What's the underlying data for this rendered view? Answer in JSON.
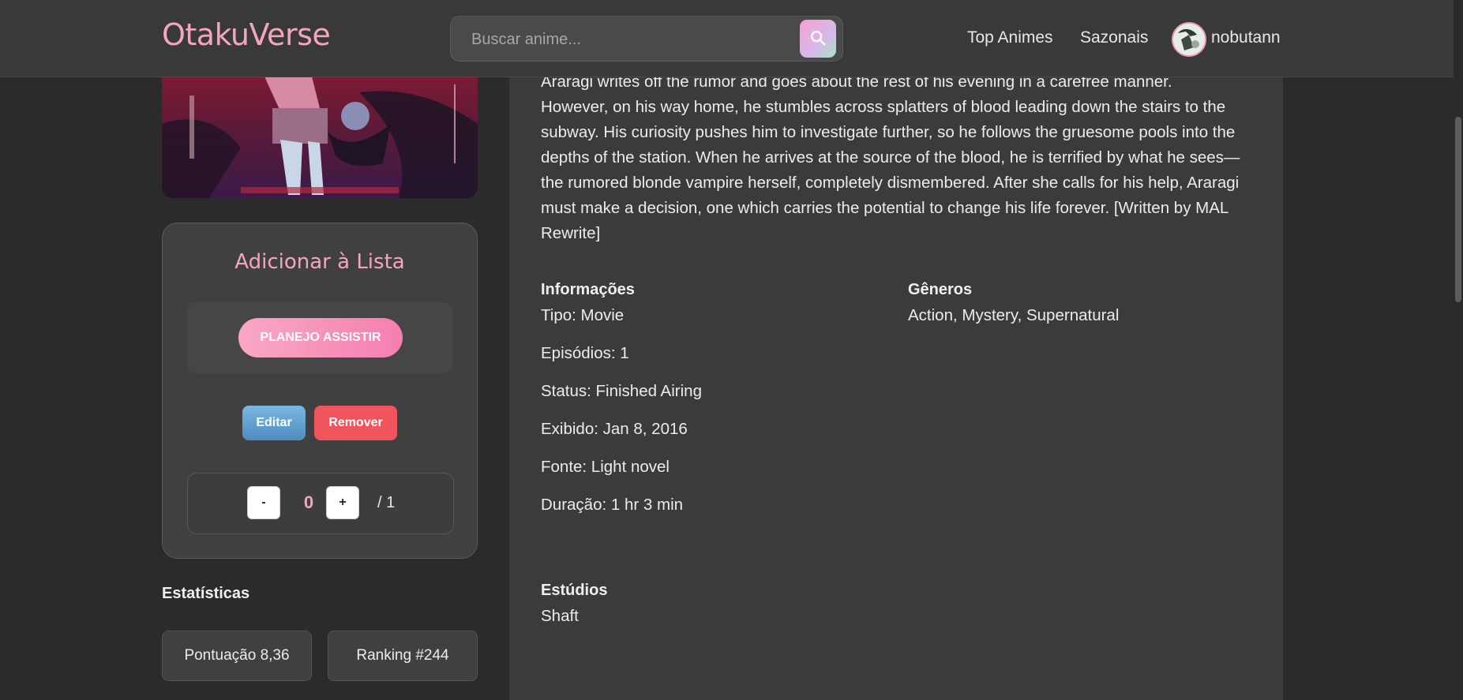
{
  "header": {
    "logo": "OtakuVerse",
    "search": {
      "placeholder": "Buscar anime..."
    },
    "nav": {
      "top": "Top Animes",
      "seasonal": "Sazonais"
    },
    "user": {
      "name": "nobutann"
    }
  },
  "list_card": {
    "title": "Adicionar à Lista",
    "status_button": "PLANEJO ASSISTIR",
    "edit": "Editar",
    "remove": "Remover",
    "minus": "-",
    "plus": "+",
    "progress": "0",
    "total": "/ 1"
  },
  "stats": {
    "heading": "Estatísticas",
    "score": "Pontuação 8,36",
    "rank": "Ranking #244"
  },
  "synopsis": "Araragi writes off the rumor and goes about the rest of his evening in a carefree manner. However, on his way home, he stumbles across splatters of blood leading down the stairs to the subway. His curiosity pushes him to investigate further, so he follows the gruesome pools into the depths of the station. When he arrives at the source of the blood, he is terrified by what he sees—the rumored blonde vampire herself, completely dismembered. After she calls for his help, Araragi must make a decision, one which carries the potential to change his life forever. [Written by MAL Rewrite]",
  "info": {
    "heading": "Informações",
    "type": "Tipo: Movie",
    "episodes": "Episódios: 1",
    "status": "Status: Finished Airing",
    "aired": "Exibido: Jan 8, 2016",
    "source": "Fonte: Light novel",
    "duration": "Duração: 1 hr 3 min"
  },
  "genres": {
    "heading": "Gêneros",
    "list": "Action, Mystery, Supernatural"
  },
  "studios": {
    "heading": "Estúdios",
    "list": "Shaft"
  },
  "colors": {
    "accent": "#f2a7bb",
    "remove": "#f0545d",
    "edit": "#5a9bcc",
    "background": "#2b2b2b"
  }
}
